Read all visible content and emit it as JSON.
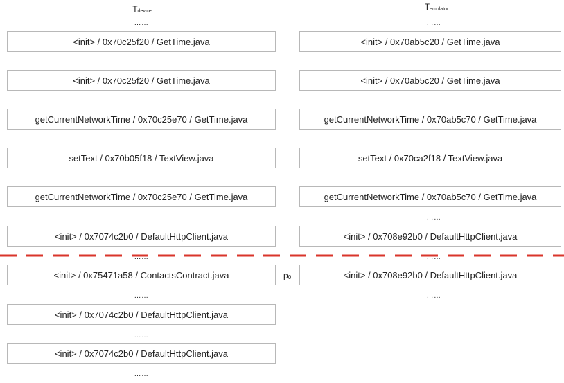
{
  "header": {
    "left_base": "T",
    "left_sub": "device",
    "right_base": "T",
    "right_sub": "emulator"
  },
  "ellipsis": "……",
  "left_boxes": [
    "<init> / 0x70c25f20 / GetTime.java",
    "<init> / 0x70c25f20 / GetTime.java",
    "getCurrentNetworkTime / 0x70c25e70 / GetTime.java",
    "setText / 0x70b05f18 / TextView.java",
    "getCurrentNetworkTime / 0x70c25e70 / GetTime.java",
    "<init> / 0x7074c2b0 / DefaultHttpClient.java",
    "<init> / 0x75471a58 / ContactsContract.java",
    "<init> / 0x7074c2b0 / DefaultHttpClient.java",
    "<init> / 0x7074c2b0 / DefaultHttpClient.java"
  ],
  "right_boxes": [
    "<init> / 0x70ab5c20 / GetTime.java",
    "<init> / 0x70ab5c20 / GetTime.java",
    "getCurrentNetworkTime / 0x70ab5c70 / GetTime.java",
    "setText / 0x70ca2f18 / TextView.java",
    "getCurrentNetworkTime / 0x70ab5c70 / GetTime.java",
    "<init> / 0x708e92b0 / DefaultHttpClient.java",
    "<init> / 0x708e92b0 / DefaultHttpClient.java"
  ],
  "marker": {
    "base": "p",
    "sub": "0"
  },
  "colors": {
    "border": "#b8b8b8",
    "cut_line": "#d9352b",
    "text": "#222222"
  }
}
